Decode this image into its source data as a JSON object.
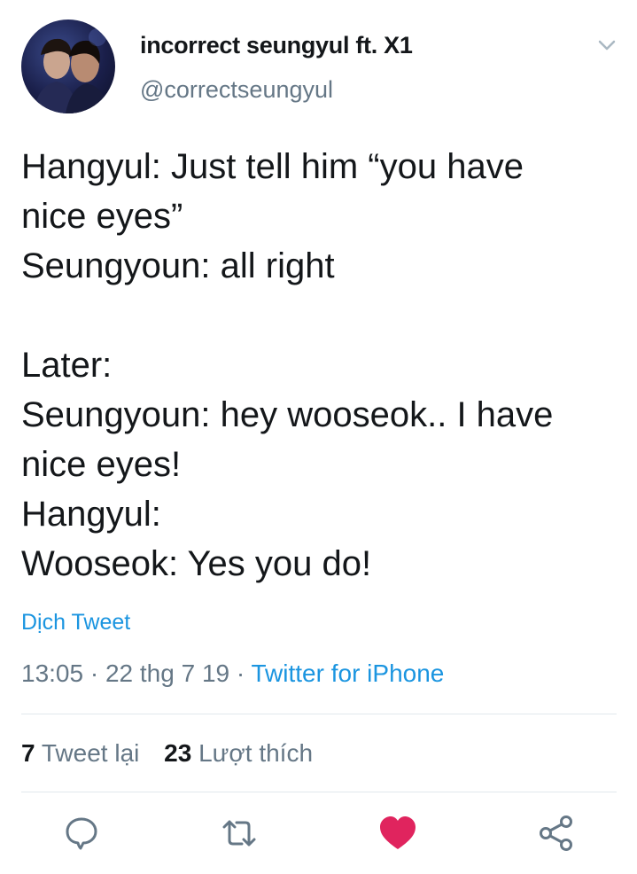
{
  "user": {
    "display_name": "incorrect seungyul ft. X1",
    "handle": "@correctseungyul"
  },
  "tweet": {
    "lines": [
      "Hangyul: Just tell him “you have",
      "nice eyes”",
      "Seungyoun: all right",
      "",
      "Later:",
      "Seungyoun: hey wooseok.. I have",
      "nice eyes!",
      "Hangyul:",
      "Wooseok: Yes you do!"
    ],
    "translate_label": "Dịch Tweet"
  },
  "meta": {
    "time": "13:05",
    "separator": " · ",
    "date": "22 thg 7 19",
    "source": "Twitter for iPhone"
  },
  "stats": {
    "retweets_count": "7",
    "retweets_label": "Tweet lại",
    "likes_count": "23",
    "likes_label": "Lượt thích"
  },
  "actions": {
    "icons": [
      "reply-icon",
      "retweet-icon",
      "like-icon",
      "share-icon"
    ]
  },
  "colors": {
    "text": "#14171a",
    "secondary": "#657786",
    "link": "#1b95e0",
    "like": "#e0245e",
    "divider": "#e1e8ed"
  }
}
